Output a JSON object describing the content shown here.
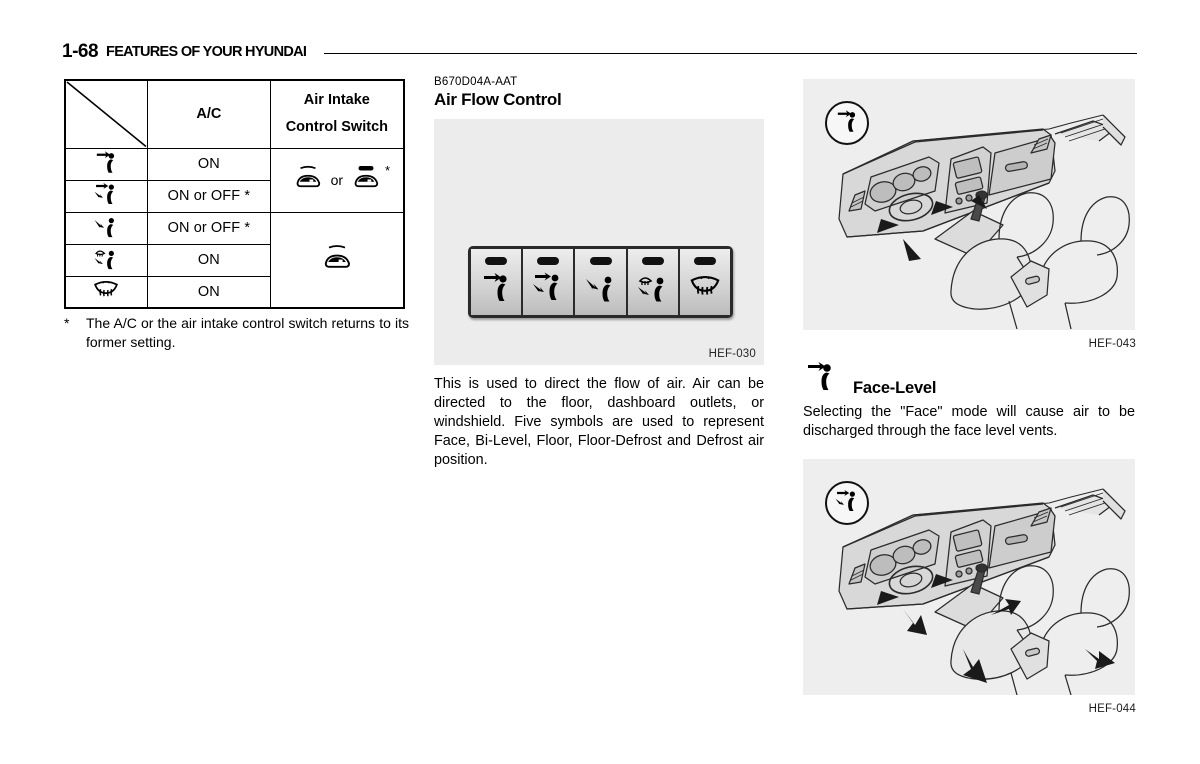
{
  "header": {
    "page_number": "1-68",
    "title": "FEATURES OF YOUR HYUNDAI"
  },
  "table": {
    "headers": {
      "corner": "",
      "ac": "A/C",
      "intake_line1": "Air Intake",
      "intake_line2": "Control Switch"
    },
    "rows": [
      {
        "mode_icon": "face-mode-icon",
        "mode_name": "Face",
        "ac": "ON"
      },
      {
        "mode_icon": "bilevel-mode-icon",
        "mode_name": "Bi-Level",
        "ac": "ON or OFF *"
      },
      {
        "mode_icon": "floor-mode-icon",
        "mode_name": "Floor",
        "ac": "ON or OFF *"
      },
      {
        "mode_icon": "floor-defrost-mode-icon",
        "mode_name": "Floor-Defrost",
        "ac": "ON"
      },
      {
        "mode_icon": "defrost-mode-icon",
        "mode_name": "Defrost",
        "ac": "ON"
      }
    ],
    "intake_group_top": {
      "icon_a": "recirculation-icon",
      "separator": "or",
      "icon_b": "fresh-air-icon",
      "asterisk": "*"
    },
    "intake_group_bottom": {
      "icon_a": "recirculation-icon"
    }
  },
  "footnote": {
    "marker": "*",
    "text": "The A/C or the air intake control switch returns to its former setting."
  },
  "middle": {
    "code": "B670D04A-AAT",
    "title": "Air Flow Control",
    "figure_label": "HEF-030",
    "switch_buttons": [
      {
        "icon": "face-mode-icon",
        "label": "Face"
      },
      {
        "icon": "bilevel-mode-icon",
        "label": "Bi-Level"
      },
      {
        "icon": "floor-mode-icon",
        "label": "Floor"
      },
      {
        "icon": "floor-defrost-mode-icon",
        "label": "Floor-Defrost"
      },
      {
        "icon": "defrost-mode-icon",
        "label": "Defrost"
      }
    ],
    "body": "This is used to direct the flow of air. Air can be directed to the floor, dashboard outlets, or windshield. Five symbols are used to represent Face, Bi-Level, Floor, Floor-Defrost and Defrost air position."
  },
  "right": {
    "figure_top": {
      "label": "HEF-043",
      "badge_icon": "face-mode-icon",
      "illustration": "car-interior-dashboard-face-airflow"
    },
    "subsection": {
      "icon": "face-mode-icon",
      "title": "Face-Level",
      "body": "Selecting the \"Face\" mode will cause air to be discharged through the face level vents."
    },
    "figure_bottom": {
      "label": "HEF-044",
      "badge_icon": "bilevel-mode-icon",
      "illustration": "car-interior-dashboard-bilevel-airflow"
    }
  },
  "colors": {
    "figure_background": "#ececec",
    "photo_background": "#eeeeee",
    "ink": "#000000",
    "panel_dark": "#2a2a2a"
  }
}
